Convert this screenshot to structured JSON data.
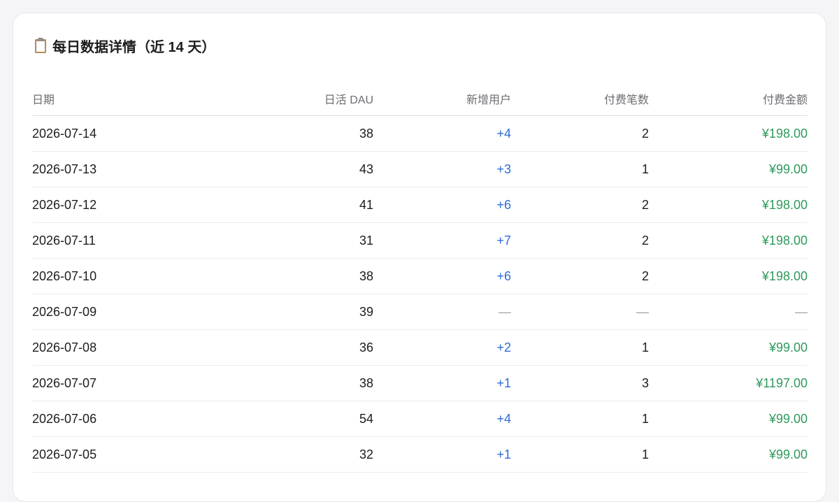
{
  "title": {
    "icon": "clipboard-icon",
    "text": "每日数据详情（近 14 天）"
  },
  "colors": {
    "new_users": "#2f6bd8",
    "amount": "#2f9a5c",
    "empty": "#a1a1a6"
  },
  "table": {
    "headers": [
      "日期",
      "日活 DAU",
      "新增用户",
      "付费笔数",
      "付费金额"
    ],
    "rows": [
      {
        "date": "2026-07-14",
        "dau": "38",
        "new_users": "+4",
        "pay_count": "2",
        "pay_amount": "¥198.00"
      },
      {
        "date": "2026-07-13",
        "dau": "43",
        "new_users": "+3",
        "pay_count": "1",
        "pay_amount": "¥99.00"
      },
      {
        "date": "2026-07-12",
        "dau": "41",
        "new_users": "+6",
        "pay_count": "2",
        "pay_amount": "¥198.00"
      },
      {
        "date": "2026-07-11",
        "dau": "31",
        "new_users": "+7",
        "pay_count": "2",
        "pay_amount": "¥198.00"
      },
      {
        "date": "2026-07-10",
        "dau": "38",
        "new_users": "+6",
        "pay_count": "2",
        "pay_amount": "¥198.00"
      },
      {
        "date": "2026-07-09",
        "dau": "39",
        "new_users": "—",
        "pay_count": "—",
        "pay_amount": "—"
      },
      {
        "date": "2026-07-08",
        "dau": "36",
        "new_users": "+2",
        "pay_count": "1",
        "pay_amount": "¥99.00"
      },
      {
        "date": "2026-07-07",
        "dau": "38",
        "new_users": "+1",
        "pay_count": "3",
        "pay_amount": "¥1197.00"
      },
      {
        "date": "2026-07-06",
        "dau": "54",
        "new_users": "+4",
        "pay_count": "1",
        "pay_amount": "¥99.00"
      },
      {
        "date": "2026-07-05",
        "dau": "32",
        "new_users": "+1",
        "pay_count": "1",
        "pay_amount": "¥99.00"
      }
    ]
  }
}
